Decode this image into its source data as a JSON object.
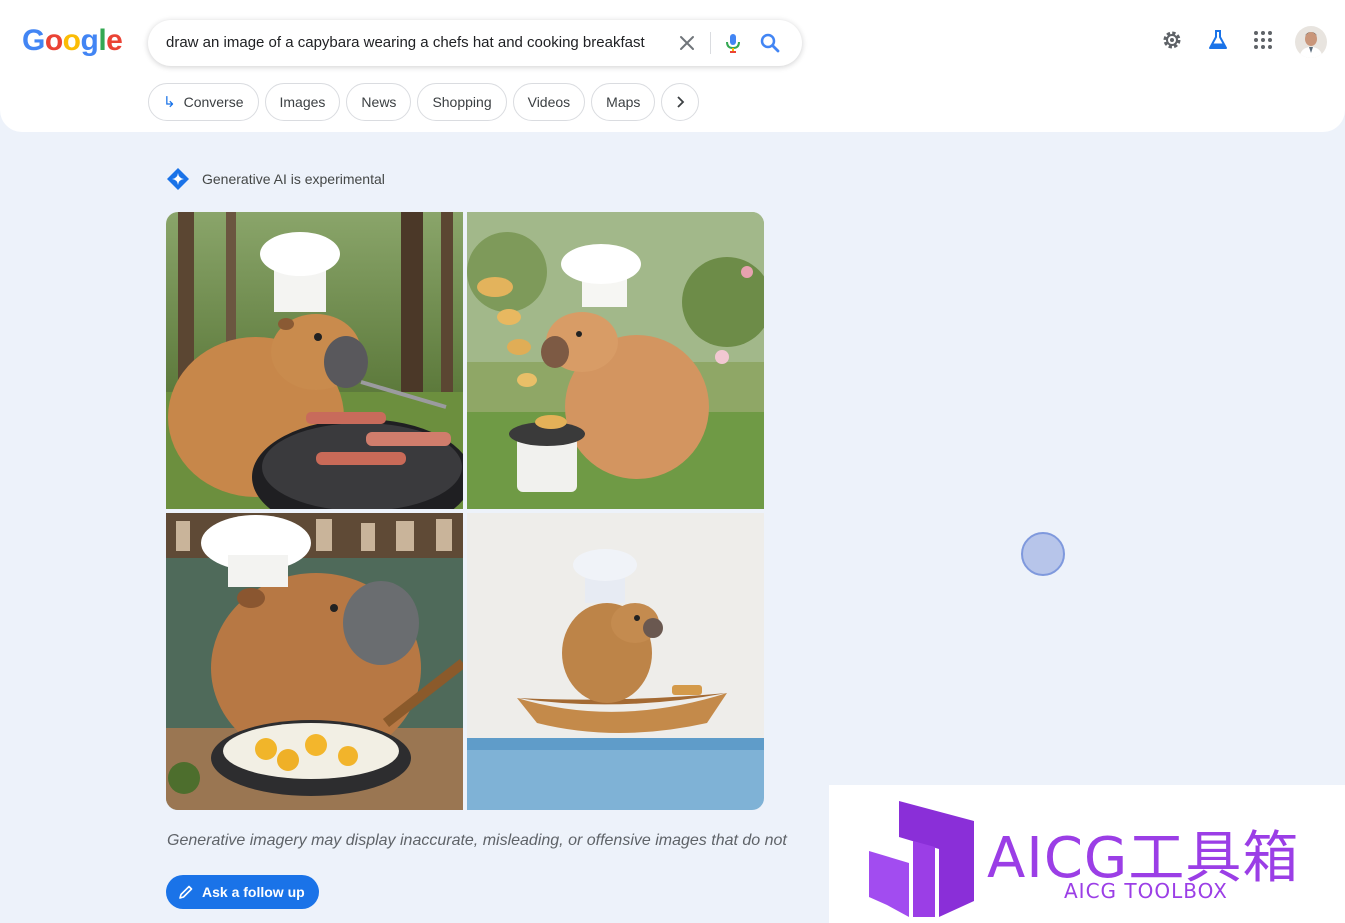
{
  "brand": {
    "logo_letters": [
      {
        "ch": "G",
        "color": "#4285f4"
      },
      {
        "ch": "o",
        "color": "#ea4335"
      },
      {
        "ch": "o",
        "color": "#fbbc05"
      },
      {
        "ch": "g",
        "color": "#4285f4"
      },
      {
        "ch": "l",
        "color": "#34a853"
      },
      {
        "ch": "e",
        "color": "#ea4335"
      }
    ]
  },
  "search": {
    "query": "draw an image of a capybara wearing a chefs hat and cooking breakfast"
  },
  "header_icons": [
    "settings-gear-icon",
    "labs-flask-icon",
    "apps-grid-icon",
    "account-avatar"
  ],
  "tabs": [
    "Converse",
    "Images",
    "News",
    "Shopping",
    "Videos",
    "Maps"
  ],
  "ai": {
    "label": "Generative AI is experimental",
    "images": [
      "capybara-chef-grilling-bacon-in-forest",
      "capybara-chef-flipping-pancakes-in-garden",
      "capybara-chef-frying-eggs-in-kitchen",
      "capybara-chef-cooking-in-boat-watercolor"
    ],
    "disclaimer": "Generative imagery may display inaccurate, misleading, or offensive images that do not",
    "followup_label": "Ask a follow up"
  },
  "watermark": {
    "title": "AICG工具箱",
    "subtitle": "AICG TOOLBOX"
  },
  "colors": {
    "accent": "#1a73e8",
    "page_bg": "#edf2fa",
    "watermark": "#9b3ee6"
  }
}
